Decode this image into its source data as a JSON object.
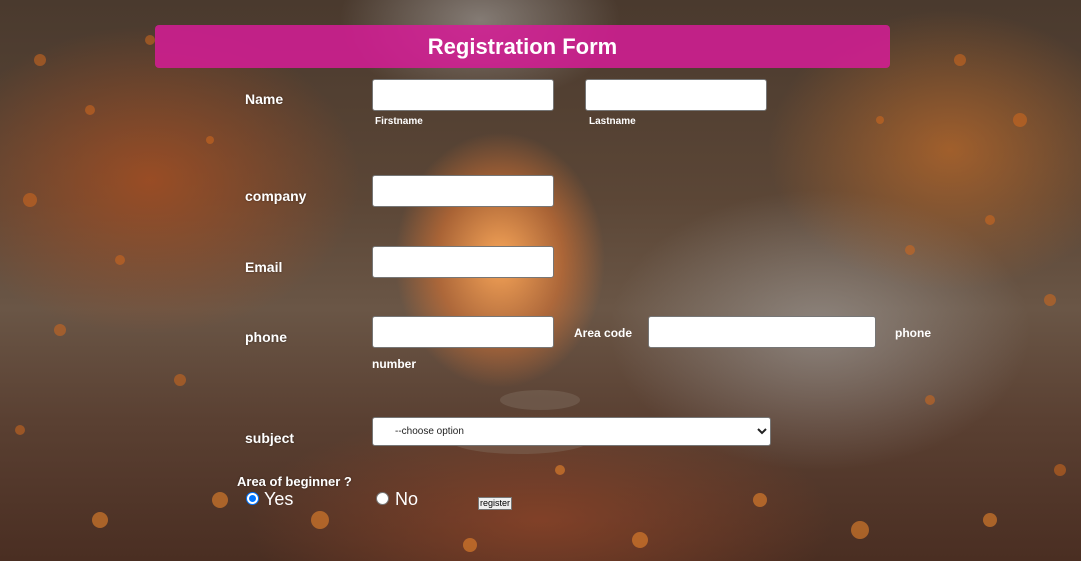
{
  "form": {
    "title": "Registration Form",
    "name_label": "Name",
    "firstname_caption": "Firstname",
    "lastname_caption": "Lastname",
    "firstname_value": "",
    "lastname_value": "",
    "company_label": "company",
    "company_value": "",
    "email_label": "Email",
    "email_value": "",
    "phone_label": "phone",
    "phone_value": "",
    "area_code_label": "Area code",
    "area_code_value": "",
    "phone_number_caption_1": "phone",
    "phone_number_caption_2": "number",
    "subject_label": "subject",
    "subject_selected": "--choose option",
    "beginner_question": "Area of beginner ?",
    "yes_label": "Yes",
    "no_label": "No",
    "yes_checked": true,
    "register_label": "register"
  },
  "colors": {
    "header_bg": "#d61c96",
    "radio_accent": "#0075ff"
  }
}
